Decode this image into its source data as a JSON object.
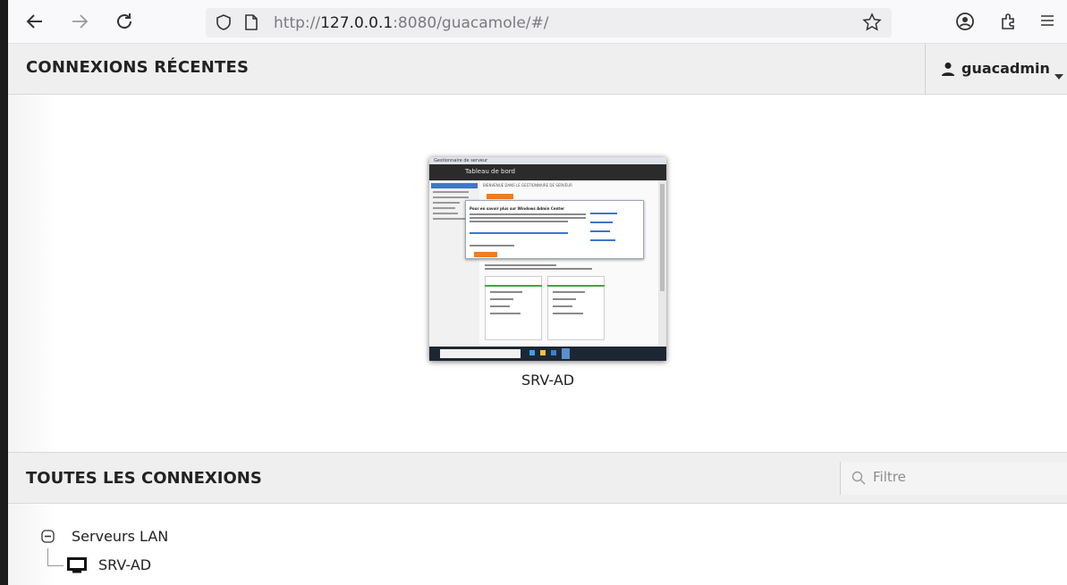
{
  "browser": {
    "url_prefix": "http://",
    "url_host": "127.0.0.1",
    "url_rest": ":8080/guacamole/#/"
  },
  "header": {
    "title": "CONNEXIONS RÉCENTES",
    "username": "guacadmin"
  },
  "recent": {
    "items": [
      {
        "name": "SRV-AD"
      }
    ],
    "thumbnail": {
      "window_title": "Gestionnaire de serveur",
      "page_title": "Tableau de bord",
      "welcome": "BIENVENUE DANS LE GESTIONNAIRE DE SERVEUR",
      "dialog_title": "Pour en savoir plus sur Windows Admin Center"
    }
  },
  "all": {
    "title": "TOUTES LES CONNEXIONS",
    "filter_placeholder": "Filtre",
    "groups": [
      {
        "name": "Serveurs LAN",
        "connections": [
          {
            "name": "SRV-AD"
          }
        ]
      }
    ]
  }
}
